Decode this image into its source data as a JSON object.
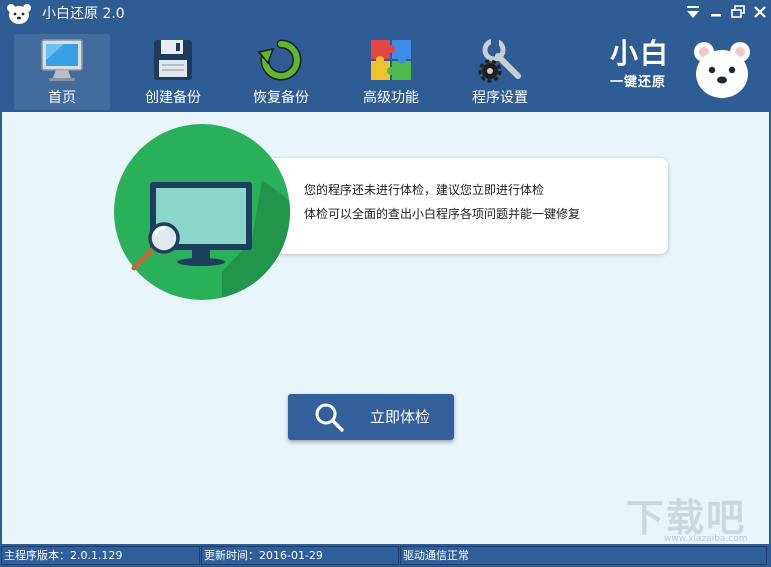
{
  "window": {
    "title": "小白还原 2.0"
  },
  "toolbar": {
    "items": [
      {
        "label": "首页",
        "icon": "monitor-icon",
        "active": true
      },
      {
        "label": "创建备份",
        "icon": "floppy-disk-icon",
        "active": false
      },
      {
        "label": "恢复备份",
        "icon": "restore-arrow-icon",
        "active": false
      },
      {
        "label": "高级功能",
        "icon": "puzzle-icon",
        "active": false
      },
      {
        "label": "程序设置",
        "icon": "wrench-gear-icon",
        "active": false
      }
    ]
  },
  "brand": {
    "title": "小白",
    "subtitle": "一键还原",
    "icon": "bear-logo-icon"
  },
  "info": {
    "line1": "您的程序还未进行体检，建议您立即进行体检",
    "line2": "体检可以全面的查出小白程序各项问题并能一键修复"
  },
  "actions": {
    "check_now_label": "立即体检",
    "check_icon": "magnifier-icon"
  },
  "watermark": {
    "text": "下载吧",
    "url": "www.xiazaiba.com"
  },
  "status": {
    "version": "主程序版本：2.0.1.129",
    "update_time": "更新时间：2016-01-29",
    "driver": "驱动通信正常"
  },
  "colors": {
    "frame": "#2e5c94",
    "content_bg": "#e8f6fb",
    "hero_green": "#2bb05a",
    "button_blue": "#33609a"
  }
}
